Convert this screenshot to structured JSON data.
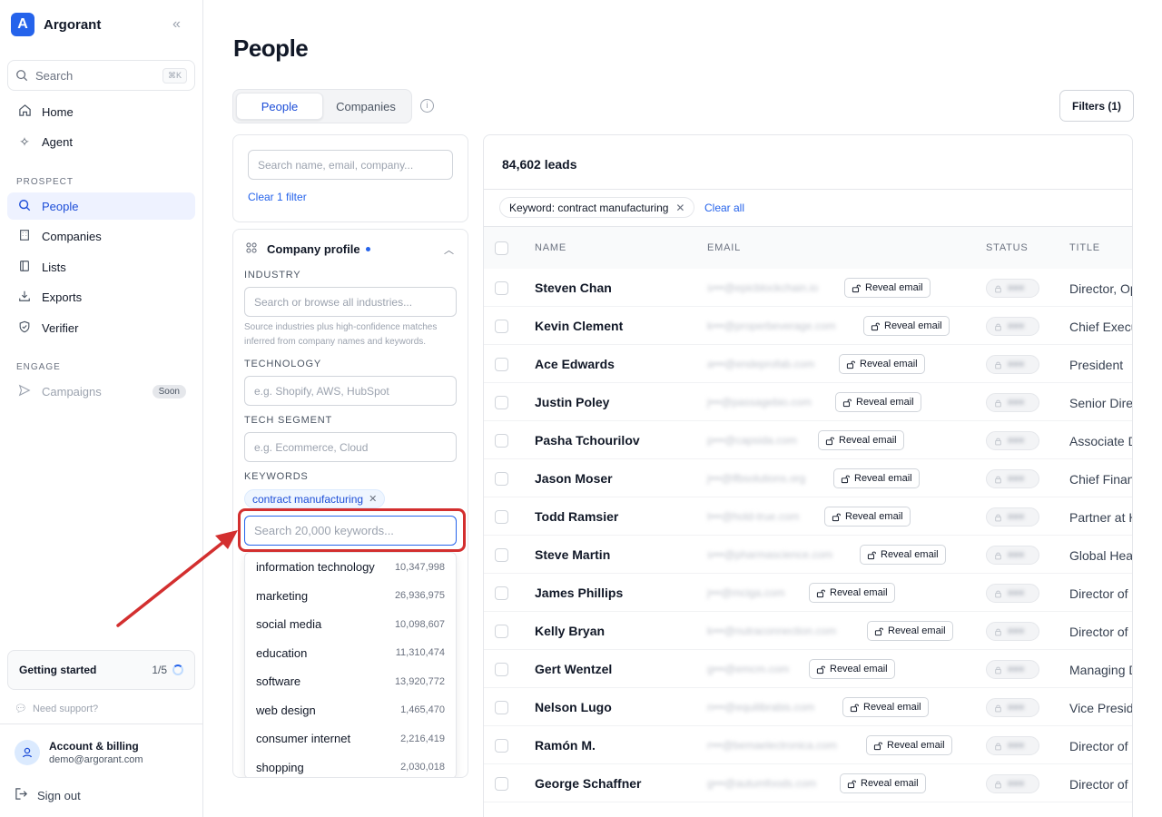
{
  "brand": {
    "name": "Argorant",
    "logo_letter": "A"
  },
  "sidebar": {
    "search_label": "Search",
    "search_shortcut": "⌘K",
    "top_items": [
      {
        "label": "Home",
        "icon": "home-icon"
      },
      {
        "label": "Agent",
        "icon": "sparkle-icon"
      }
    ],
    "prospect_label": "PROSPECT",
    "prospect_items": [
      {
        "label": "People",
        "icon": "search-icon",
        "active": true
      },
      {
        "label": "Companies",
        "icon": "building-icon"
      },
      {
        "label": "Lists",
        "icon": "book-icon"
      },
      {
        "label": "Exports",
        "icon": "download-icon"
      },
      {
        "label": "Verifier",
        "icon": "shield-icon"
      }
    ],
    "engage_label": "ENGAGE",
    "engage_items": [
      {
        "label": "Campaigns",
        "icon": "send-icon",
        "badge": "Soon",
        "disabled": true
      }
    ],
    "getting_started": {
      "title": "Getting started",
      "progress": "1/5"
    },
    "need_support": "Need support?",
    "account": {
      "title": "Account & billing",
      "email": "demo@argorant.com"
    },
    "sign_out": "Sign out"
  },
  "page": {
    "title": "People",
    "tabs": [
      "People",
      "Companies"
    ],
    "active_tab": "People",
    "filters_button": "Filters (1)"
  },
  "filter_panel": {
    "search_placeholder": "Search name, email, company...",
    "clear_filter": "Clear 1 filter",
    "company_profile": {
      "title": "Company profile",
      "industry_label": "INDUSTRY",
      "industry_placeholder": "Search or browse all industries...",
      "industry_help": "Source industries plus high-confidence matches inferred from company names and keywords.",
      "technology_label": "TECHNOLOGY",
      "technology_placeholder": "e.g. Shopify, AWS, HubSpot",
      "tech_segment_label": "TECH SEGMENT",
      "tech_segment_placeholder": "e.g. Ecommerce, Cloud",
      "keywords_label": "KEYWORDS",
      "selected_keyword": "contract manufacturing",
      "keyword_search_placeholder": "Search 20,000 keywords...",
      "keyword_suggestions": [
        {
          "label": "information technology",
          "count": "10,347,998"
        },
        {
          "label": "marketing",
          "count": "26,936,975"
        },
        {
          "label": "social media",
          "count": "10,098,607"
        },
        {
          "label": "education",
          "count": "11,310,474"
        },
        {
          "label": "software",
          "count": "13,920,772"
        },
        {
          "label": "web design",
          "count": "1,465,470"
        },
        {
          "label": "consumer internet",
          "count": "2,216,419"
        },
        {
          "label": "shopping",
          "count": "2,030,018"
        }
      ]
    }
  },
  "leads": {
    "count_label": "84,602 leads",
    "active_filter_chip": "Keyword: contract manufacturing",
    "clear_all": "Clear all",
    "columns": [
      "NAME",
      "EMAIL",
      "STATUS",
      "TITLE"
    ],
    "reveal_label": "Reveal email",
    "rows": [
      {
        "name": "Steven Chan",
        "email": "s•••@epicblockchain.io",
        "title": "Director, Op"
      },
      {
        "name": "Kevin Clement",
        "email": "k•••@properbeverage.com",
        "title": "Chief Execu"
      },
      {
        "name": "Ace Edwards",
        "email": "a•••@endeprofab.com",
        "title": "President"
      },
      {
        "name": "Justin Poley",
        "email": "j•••@passagebio.com",
        "title": "Senior Dire"
      },
      {
        "name": "Pasha Tchourilov",
        "email": "p•••@capsida.com",
        "title": "Associate D"
      },
      {
        "name": "Jason Moser",
        "email": "j•••@lfbsolutions.org",
        "title": "Chief Finan"
      },
      {
        "name": "Todd Ramsier",
        "email": "t•••@hold-true.com",
        "title": "Partner at H"
      },
      {
        "name": "Steve Martin",
        "email": "s•••@pharmascience.com",
        "title": "Global Hea"
      },
      {
        "name": "James Phillips",
        "email": "j•••@mciga.com",
        "title": "Director of"
      },
      {
        "name": "Kelly Bryan",
        "email": "k•••@nutraconnection.com",
        "title": "Director of"
      },
      {
        "name": "Gert Wentzel",
        "email": "g•••@emcm.com",
        "title": "Managing D"
      },
      {
        "name": "Nelson Lugo",
        "email": "n•••@equilibrabis.com",
        "title": "Vice Presid"
      },
      {
        "name": "Ramón M.",
        "email": "r•••@bemaelectronica.com",
        "title": "Director of"
      },
      {
        "name": "George Schaffner",
        "email": "g•••@autumfoods.com",
        "title": "Director of"
      }
    ]
  },
  "colors": {
    "accent": "#2563eb",
    "annotation": "#d32f2f"
  }
}
